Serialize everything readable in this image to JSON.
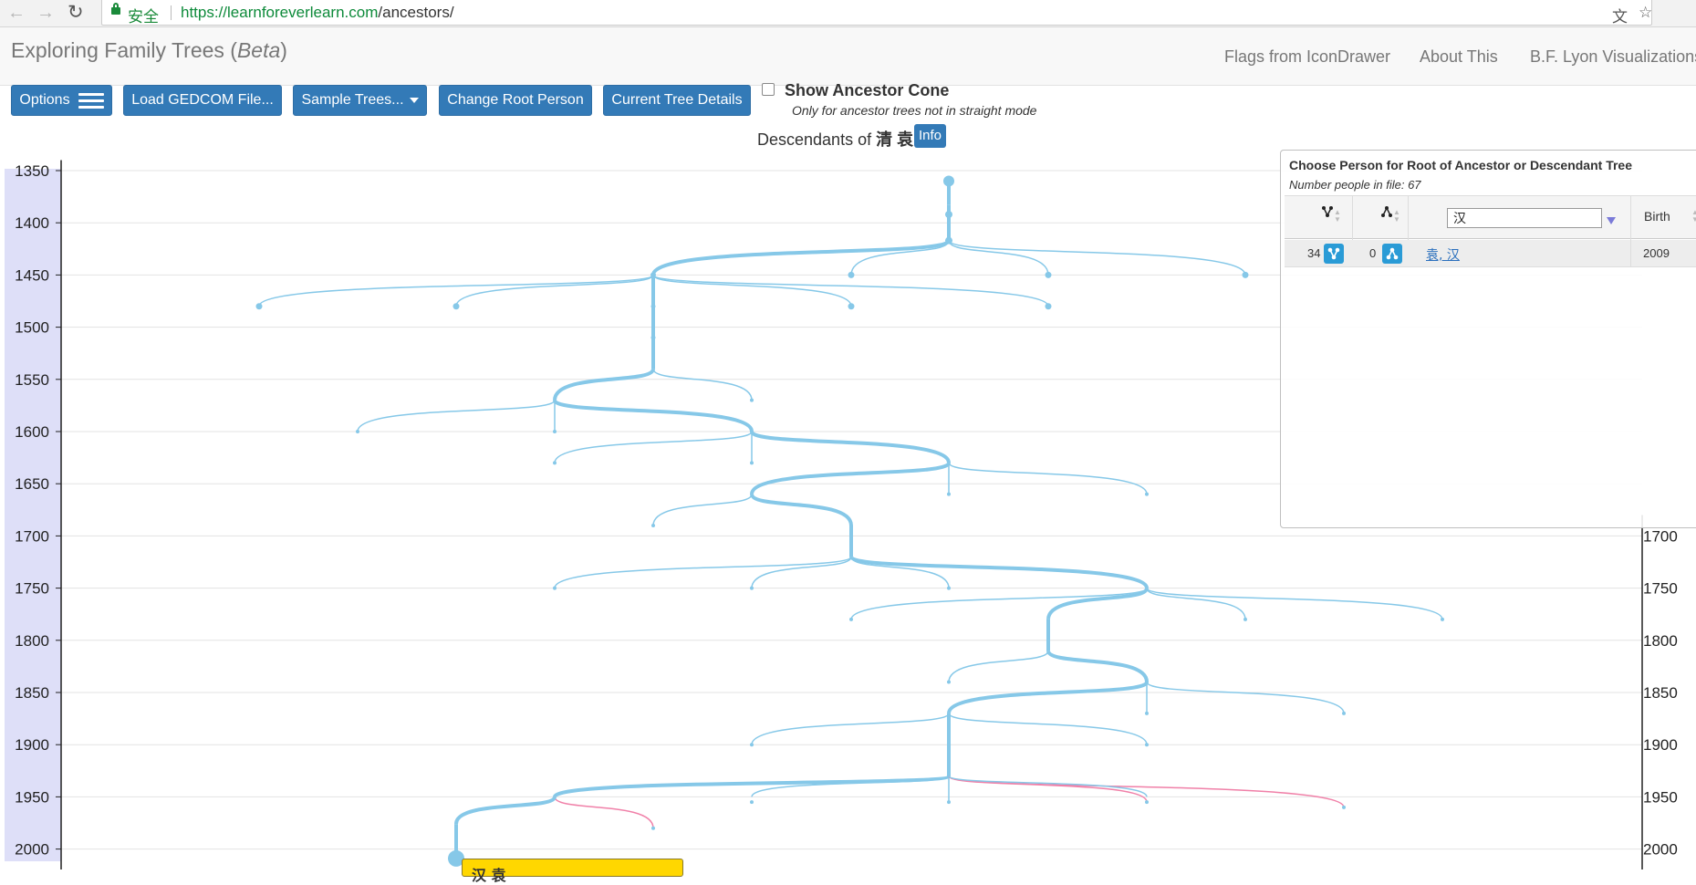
{
  "browser": {
    "secure_label": "安全",
    "url_scheme": "https://",
    "url_host": "learnforeverlearn.com",
    "url_path": "/ancestors/"
  },
  "header": {
    "title_main": "Exploring Family Trees (",
    "title_em": "Beta",
    "title_end": ")",
    "nav": [
      "Flags from IconDrawer",
      "About This",
      "B.F. Lyon Visualizations"
    ]
  },
  "toolbar": {
    "options_label": "Options",
    "load_label": "Load GEDCOM File...",
    "sample_label": "Sample Trees...",
    "change_root_label": "Change Root Person",
    "current_details_label": "Current Tree Details",
    "cone_label": "Show Ancestor Cone",
    "cone_note": "Only for ancestor trees not in straight mode"
  },
  "tree": {
    "title_prefix": "Descendants of",
    "root_name": "清 袁",
    "info_label": "Info",
    "popup_name": "汉 袁",
    "colors": {
      "line": "#86c8e8",
      "female_line": "#f080a8",
      "axis_band": "#dedff8",
      "grid": "#e3e3e3",
      "popup": "#ffd700"
    }
  },
  "chart_data": {
    "type": "tree",
    "y_axis_ticks": [
      1350,
      1400,
      1450,
      1500,
      1550,
      1600,
      1650,
      1700,
      1750,
      1800,
      1850,
      1900,
      1950,
      2000
    ],
    "ylim": [
      1340,
      2010
    ],
    "right_axis_visible_ticks": [
      1700,
      1750,
      1800,
      1850,
      1900,
      1950,
      2000
    ]
  },
  "panel": {
    "title": "Choose Person for Root of Ancestor or Descendant Tree",
    "subtitle": "Number people in file: 67",
    "filter_value": "汉",
    "birth_header": "Birth",
    "rows": [
      {
        "descendants": "34",
        "ancestors": "0",
        "name": "袁, 汉",
        "birth": "2009"
      }
    ]
  }
}
